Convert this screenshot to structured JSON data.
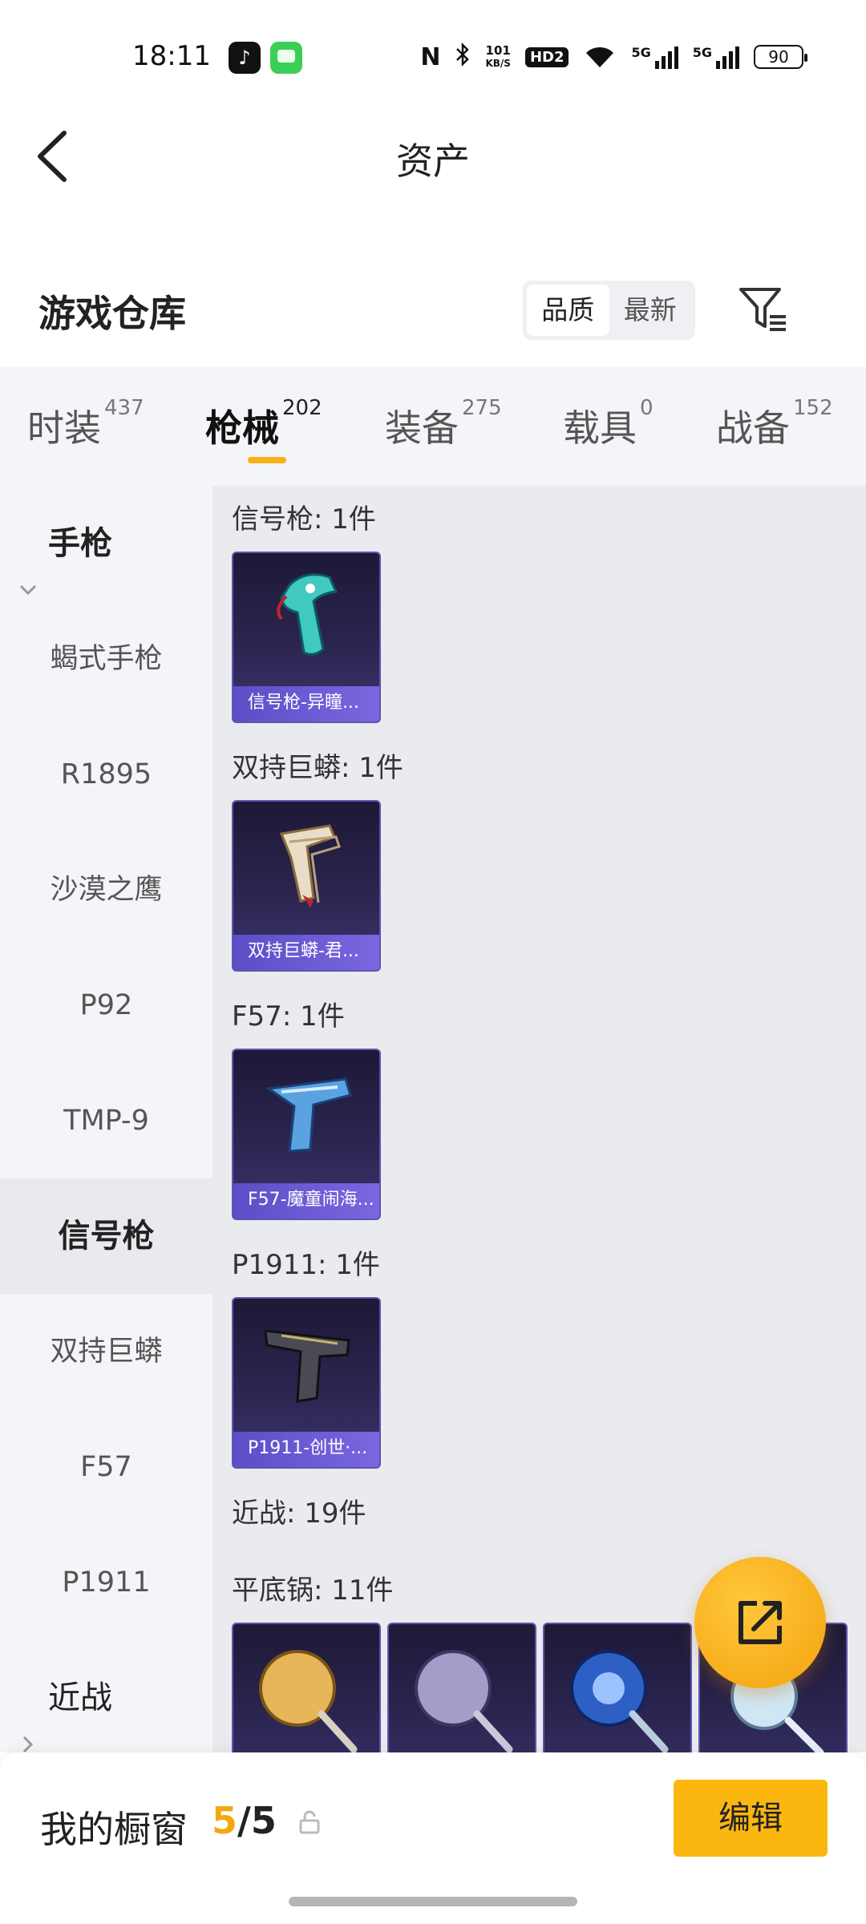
{
  "status_bar": {
    "time": "18:11",
    "net_speed_top": "101",
    "net_speed_bottom": "KB/S",
    "hd_label": "HD2",
    "signal_label_1": "5G",
    "signal_label_2": "5G",
    "battery": "90",
    "icons": [
      "tiktok-icon",
      "message-icon",
      "nfc-icon",
      "bluetooth-icon",
      "wifi-icon",
      "signal-icon",
      "battery-icon"
    ]
  },
  "header": {
    "title": "资产"
  },
  "warehouse": {
    "title": "游戏仓库",
    "sort": {
      "quality": "品质",
      "latest": "最新",
      "active": "quality"
    }
  },
  "tabs": [
    {
      "label": "时装",
      "count": "437"
    },
    {
      "label": "枪械",
      "count": "202",
      "active": true
    },
    {
      "label": "装备",
      "count": "275"
    },
    {
      "label": "载具",
      "count": "0"
    },
    {
      "label": "战备",
      "count": "152"
    }
  ],
  "sidebar": {
    "group_pistol": "手枪",
    "items": [
      "蝎式手枪",
      "R1895",
      "沙漠之鹰",
      "P92",
      "TMP-9",
      "信号枪",
      "双持巨蟒",
      "F57",
      "P1911"
    ],
    "selected": "信号枪",
    "group_melee": "近战"
  },
  "sections": [
    {
      "label": "信号枪: 1件",
      "cards": [
        {
          "caption": "信号枪-异瞳..."
        }
      ]
    },
    {
      "label": "双持巨蟒: 1件",
      "cards": [
        {
          "caption": "双持巨蟒-君..."
        }
      ]
    },
    {
      "label": "F57: 1件",
      "cards": [
        {
          "caption": "F57-魔童闹海..."
        }
      ]
    },
    {
      "label": "P1911: 1件",
      "cards": [
        {
          "caption": "P1911-创世·..."
        }
      ]
    },
    {
      "label": "近战: 19件"
    },
    {
      "label": "平底锅: 11件"
    }
  ],
  "bottom_bar": {
    "title": "我的橱窗",
    "current": "5",
    "separator": "/",
    "total": "5",
    "edit": "编辑"
  },
  "colors": {
    "accent": "#fbb60f",
    "card_bg": "#2b2550",
    "caption_bg": "#6a5ad6"
  }
}
